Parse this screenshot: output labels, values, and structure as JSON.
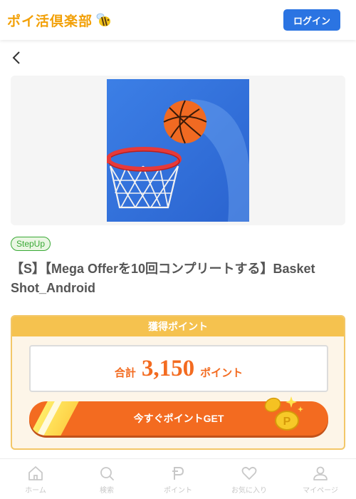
{
  "header": {
    "logo_text": "ポイ活倶楽部",
    "login_label": "ログイン"
  },
  "offer": {
    "tag": "StepUp",
    "title": "【S】【Mega Offerを10回コンプリートする】Basket Shot_Android"
  },
  "points": {
    "heading": "獲得ポイント",
    "total_label": "合計",
    "value": "3,150",
    "unit": "ポイント",
    "get_button": "今すぐポイントGET"
  },
  "nav": {
    "items": [
      {
        "label": "ホーム",
        "icon": "home-icon"
      },
      {
        "label": "検索",
        "icon": "search-icon"
      },
      {
        "label": "ポイント",
        "icon": "point-icon"
      },
      {
        "label": "お気に入り",
        "icon": "heart-icon"
      },
      {
        "label": "マイページ",
        "icon": "user-icon"
      }
    ]
  },
  "colors": {
    "brand": "#f2a007",
    "login": "#2b74e2",
    "accent": "#f36b20",
    "tag_green": "#39a935",
    "points_border": "#f3c768"
  }
}
